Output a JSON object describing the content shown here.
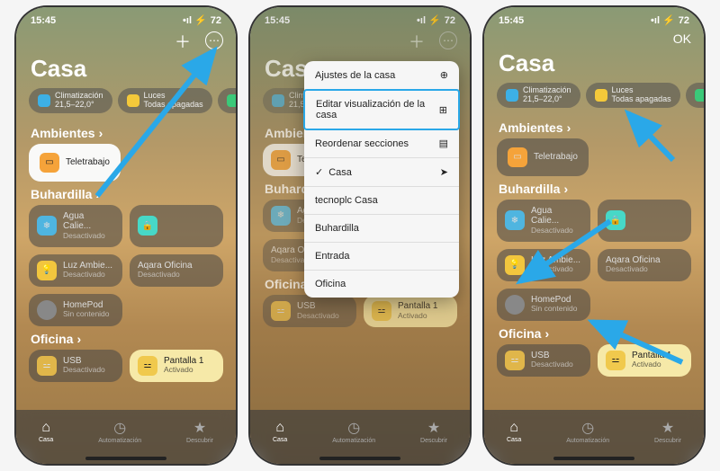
{
  "status": {
    "time": "15:45",
    "battery": "72"
  },
  "header": {
    "done": "OK"
  },
  "title": "Casa",
  "pills": {
    "clima": {
      "label": "Climatización",
      "sub": "21,5–22,0°"
    },
    "luces": {
      "label": "Luces",
      "sub": "Todas apagadas"
    }
  },
  "sections": {
    "ambientes": "Ambientes",
    "buhardilla": "Buhardilla",
    "oficina": "Oficina"
  },
  "cards": {
    "teletrabajo": {
      "label": "Teletrabajo"
    },
    "agua": {
      "label": "Agua Calie...",
      "sub": "Desactivado"
    },
    "aqara_top": {
      "label": ""
    },
    "luz": {
      "label": "Luz Ambie...",
      "sub": "Desactivado"
    },
    "aqara": {
      "label": "Aqara Oficina",
      "sub": "Desactivado"
    },
    "homepod": {
      "label": "HomePod",
      "sub": "Sin contenido"
    },
    "usb": {
      "label": "USB",
      "sub": "Desactivado"
    },
    "pantalla": {
      "label": "Pantalla 1",
      "sub": "Activado"
    }
  },
  "cards_truncated": {
    "teletrabajo": "Tele",
    "agua": "Agua"
  },
  "tabs": {
    "casa": "Casa",
    "auto": "Automatización",
    "desc": "Descubrir"
  },
  "menu": {
    "ajustes": "Ajustes de la casa",
    "editar": "Editar visualización de la casa",
    "reordenar": "Reordenar secciones",
    "casa": "Casa",
    "tecno": "tecnoplc Casa",
    "buhardilla": "Buhardilla",
    "entrada": "Entrada",
    "oficina": "Oficina"
  }
}
